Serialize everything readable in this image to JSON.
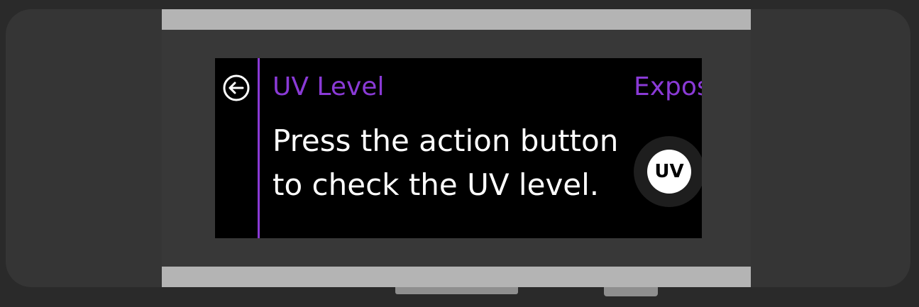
{
  "screen": {
    "back_icon": "back-arrow-circle-icon",
    "current_panel": {
      "title": "UV Level",
      "body": "Press the action button to check the UV level."
    },
    "next_panel": {
      "title": "Expos",
      "button_icon": "uv-icon",
      "button_label": "UV"
    }
  },
  "colors": {
    "accent": "#8a3ad6",
    "screen_bg": "#000000",
    "bezel": "#b4b4b4",
    "band": "#353535",
    "text": "#ffffff"
  }
}
